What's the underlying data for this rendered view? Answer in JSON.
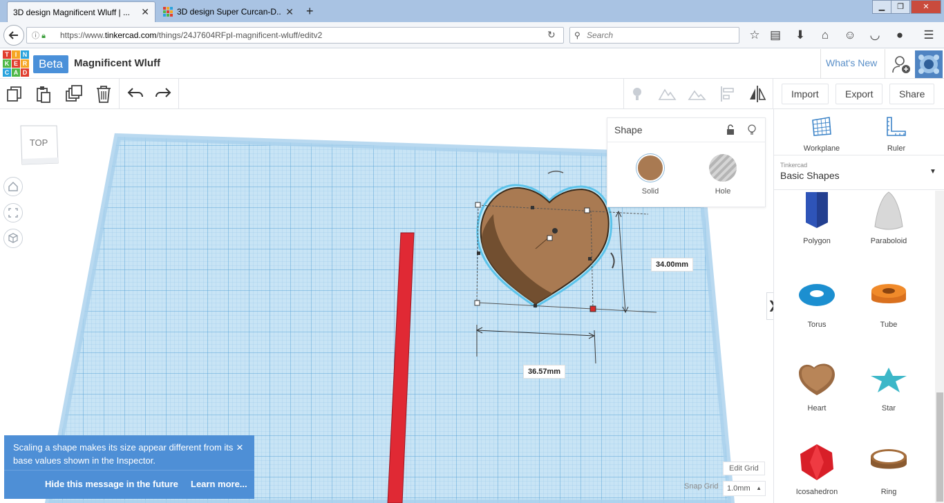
{
  "browser": {
    "tabs": [
      {
        "title": "3D design Magnificent Wluff | ...",
        "active": true
      },
      {
        "title": "3D design Super Curcan-D...",
        "active": false
      }
    ],
    "new_tab": "+",
    "url_prefix": "https://www.",
    "url_host": "tinkercad.com",
    "url_path": "/things/24J7604RFpI-magnificent-wluff/editv2",
    "search_placeholder": "Search",
    "window_controls": [
      "minimize-icon",
      "restore-icon",
      "close-icon"
    ]
  },
  "header": {
    "logo_letters": [
      "T",
      "I",
      "N",
      "K",
      "E",
      "R",
      "C",
      "A",
      "D"
    ],
    "beta": "Beta",
    "design_title": "Magnificent Wluff",
    "whats_new": "What's New"
  },
  "toolbar": {
    "import": "Import",
    "export": "Export",
    "share": "Share"
  },
  "viewport": {
    "viewcube_face": "TOP",
    "width_dim": "36.57mm",
    "height_dim": "34.00mm"
  },
  "inspector": {
    "title": "Shape",
    "solid": "Solid",
    "hole": "Hole",
    "solid_color": "#a97a52"
  },
  "toast": {
    "message": "Scaling a shape makes its size appear different from its base values shown in the Inspector.",
    "close": "×",
    "hide": "Hide this message in the future",
    "learn": "Learn more..."
  },
  "grid": {
    "edit_grid": "Edit Grid",
    "snap_label": "Snap Grid",
    "snap_value": "1.0mm"
  },
  "panel": {
    "workplane": "Workplane",
    "ruler": "Ruler",
    "library_source": "Tinkercad",
    "library_name": "Basic Shapes",
    "shapes": [
      {
        "name": "Polygon"
      },
      {
        "name": "Paraboloid"
      },
      {
        "name": "Torus"
      },
      {
        "name": "Tube"
      },
      {
        "name": "Heart"
      },
      {
        "name": "Star"
      },
      {
        "name": "Icosahedron"
      },
      {
        "name": "Ring"
      }
    ]
  }
}
